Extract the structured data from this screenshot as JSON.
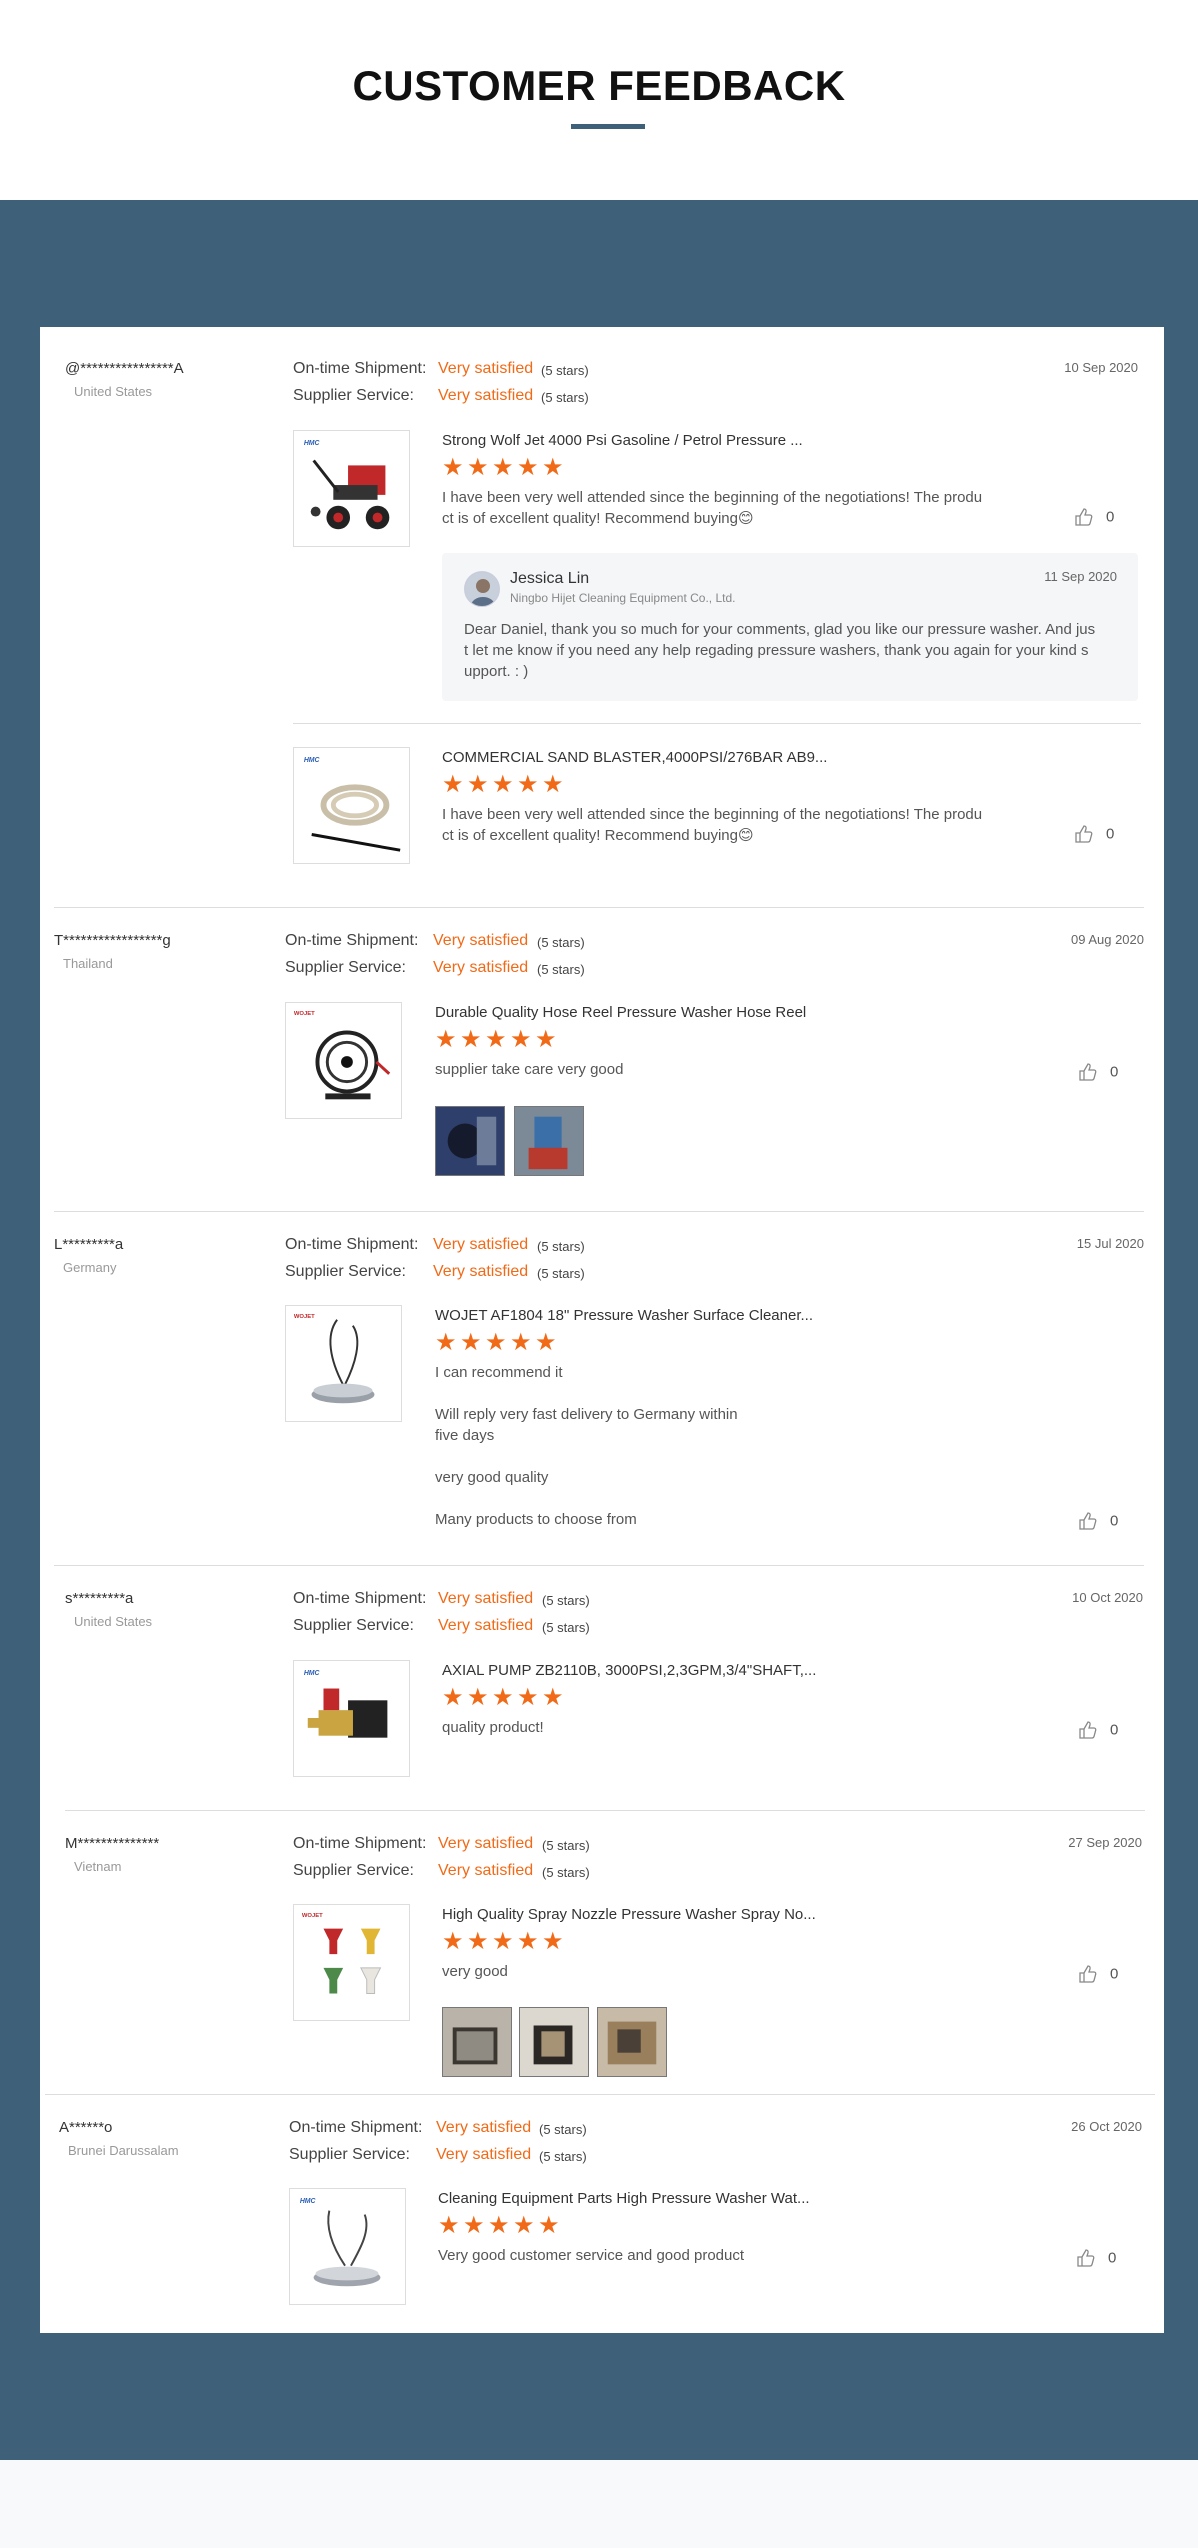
{
  "header": {
    "title": "CUSTOMER FEEDBACK"
  },
  "labels": {
    "ontime": "On-time Shipment:",
    "supplier": "Supplier Service:",
    "very_satisfied": "Very satisfied",
    "five_stars": "(5 stars)"
  },
  "colors": {
    "accent": "#f06a18",
    "band": "#3f6079"
  },
  "reviews": [
    {
      "user": "@****************A",
      "country": "United States",
      "date": "10 Sep 2020",
      "ontime_rating": 5,
      "supplier_rating": 5,
      "items": [
        {
          "product": "Strong Wolf Jet 4000 Psi Gasoline / Petrol Pressure ...",
          "stars": 5,
          "comment_line1": "I have been very well attended since the beginning of the negotiations!  The produ",
          "comment_line2": "ct is of excellent quality!  Recommend buying😊",
          "likes": "0",
          "thumb_icon": "pressure-washer-image",
          "reply": {
            "name": "Jessica Lin",
            "company": "Ningbo Hijet Cleaning Equipment Co., Ltd.",
            "date": "11 Sep 2020",
            "line1": "Dear Daniel, thank you so much for your comments, glad you like our pressure washer. And jus",
            "line2": "t let me know if you need any help regading pressure washers, thank you again for your kind s",
            "line3": "upport. : )"
          }
        },
        {
          "product": "COMMERCIAL SAND BLASTER,4000PSI/276BAR AB9...",
          "stars": 5,
          "comment_line1": "I have been very well attended since the beginning of the negotiations!  The produ",
          "comment_line2": "ct is of excellent quality!  Recommend buying😊",
          "likes": "0",
          "thumb_icon": "sand-blaster-hose-image"
        }
      ]
    },
    {
      "user": "T*****************g",
      "country": "Thailand",
      "date": "09 Aug 2020",
      "ontime_rating": 5,
      "supplier_rating": 5,
      "product": "Durable Quality Hose Reel Pressure Washer Hose Reel",
      "stars": 5,
      "comment": "supplier take care very good",
      "likes": "0",
      "thumb_icon": "hose-reel-image",
      "photos": [
        "customer-photo-1",
        "customer-photo-2"
      ]
    },
    {
      "user": "L*********a",
      "country": "Germany",
      "date": "15 Jul 2020",
      "ontime_rating": 5,
      "supplier_rating": 5,
      "product": "WOJET AF1804 18\" Pressure Washer Surface Cleaner...",
      "stars": 5,
      "comment_lines": [
        "I can recommend it",
        "Will reply very fast delivery to Germany within",
        "five days",
        "very good quality",
        "Many products to choose from"
      ],
      "likes": "0",
      "thumb_icon": "surface-cleaner-image"
    },
    {
      "user": "s*********a",
      "country": "United States",
      "date": "10 Oct 2020",
      "ontime_rating": 5,
      "supplier_rating": 5,
      "product": "AXIAL PUMP ZB2110B, 3000PSI,2,3GPM,3/4\"SHAFT,...",
      "stars": 5,
      "comment": "quality product!",
      "likes": "0",
      "thumb_icon": "axial-pump-image"
    },
    {
      "user": "M**************",
      "country": "Vietnam",
      "date": "27 Sep 2020",
      "ontime_rating": 5,
      "supplier_rating": 5,
      "product": "High Quality Spray Nozzle Pressure Washer Spray No...",
      "stars": 5,
      "comment": "very good",
      "likes": "0",
      "thumb_icon": "spray-nozzles-image",
      "photos": [
        "customer-photo-1",
        "customer-photo-2",
        "customer-photo-3"
      ]
    },
    {
      "user": "A******o",
      "country": "Brunei Darussalam",
      "date": "26 Oct 2020",
      "ontime_rating": 5,
      "supplier_rating": 5,
      "product": "Cleaning Equipment Parts High Pressure Washer Wat...",
      "stars": 5,
      "comment": "Very good customer service and good product",
      "likes": "0",
      "thumb_icon": "surface-cleaner-image"
    }
  ]
}
